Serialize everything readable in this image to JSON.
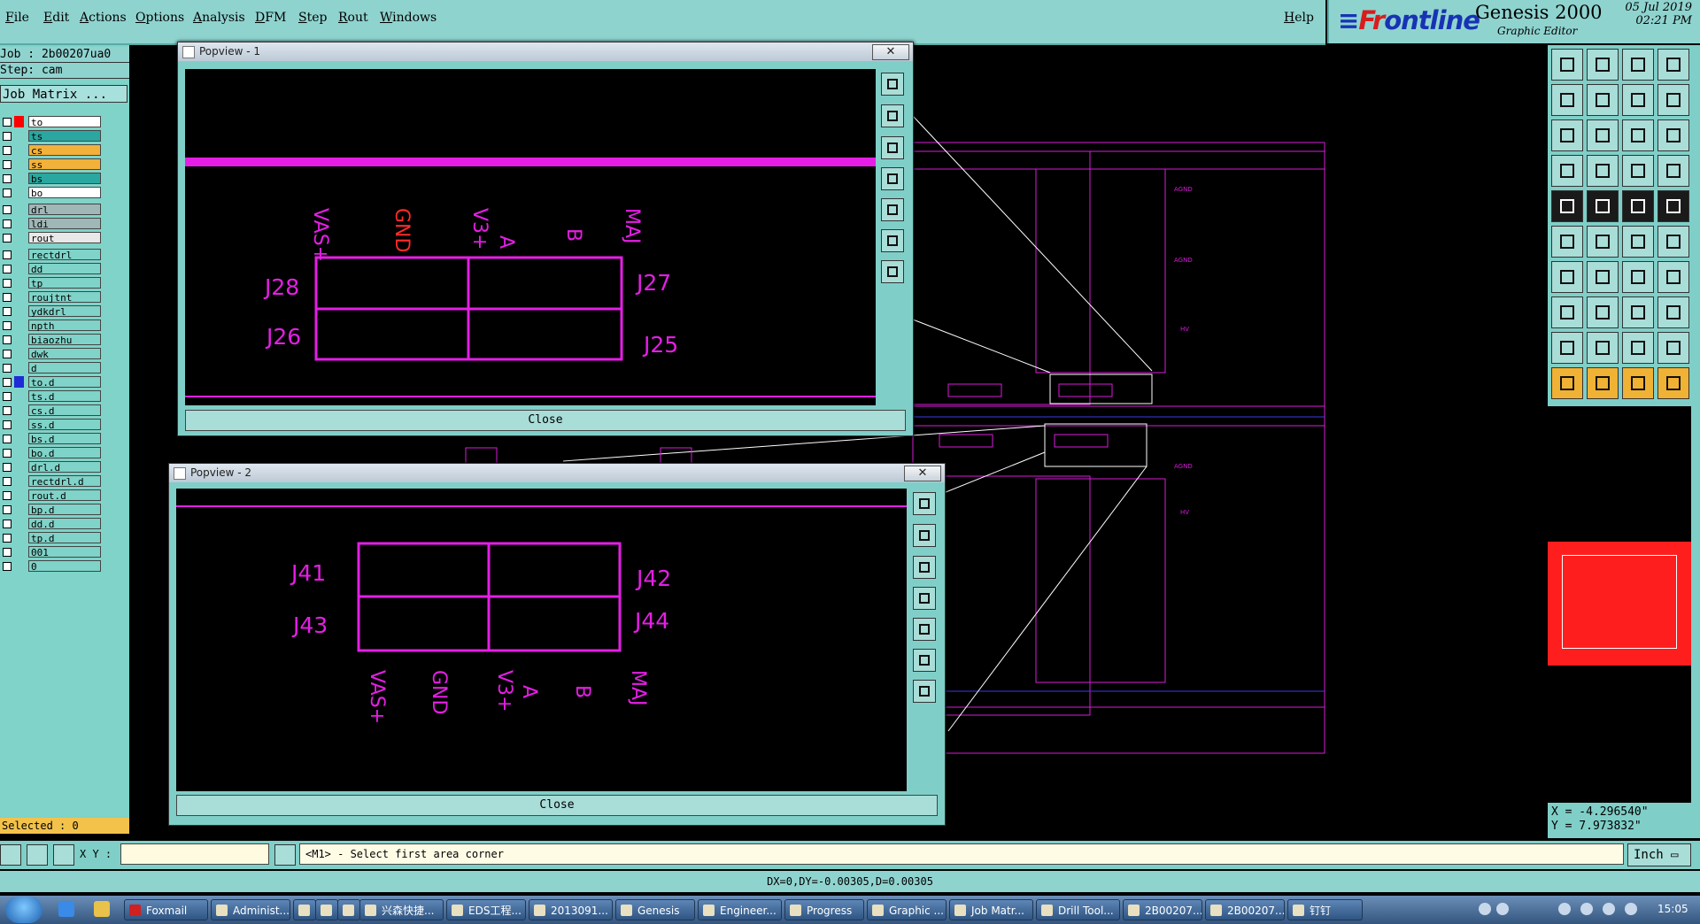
{
  "menu": [
    "File",
    "Edit",
    "Actions",
    "Options",
    "Analysis",
    "DFM",
    "Step",
    "Rout",
    "Windows"
  ],
  "help": "Help",
  "brand": {
    "logo_prefix": "Fr",
    "logo_rest": "ontline",
    "product": "Genesis 2000",
    "subtitle": "Graphic Editor",
    "date": "05 Jul 2019",
    "time": "02:21 PM"
  },
  "job": {
    "job_line": "Job : 2b00207ua0",
    "step_line": "Step: cam",
    "matrix": "Job Matrix ..."
  },
  "layers": [
    {
      "name": "to",
      "color": "#ffffff",
      "swatch": "#ff0000"
    },
    {
      "name": "ts",
      "color": "#2aa7a0"
    },
    {
      "name": "cs",
      "color": "#f2b13a"
    },
    {
      "name": "ss",
      "color": "#f2b13a"
    },
    {
      "name": "bs",
      "color": "#2aa7a0"
    },
    {
      "name": "bo",
      "color": "#ffffff"
    },
    {
      "name": "drl",
      "color": "#9fb7b7"
    },
    {
      "name": "ldi",
      "color": "#9fb7b7"
    },
    {
      "name": "rout",
      "color": "#e8e8e8"
    },
    {
      "name": "rectdrl",
      "color": "#7fd3c8"
    },
    {
      "name": "dd",
      "color": "#7fd3c8"
    },
    {
      "name": "tp",
      "color": "#7fd3c8"
    },
    {
      "name": "roujtnt",
      "color": "#7fd3c8"
    },
    {
      "name": "ydkdrl",
      "color": "#7fd3c8"
    },
    {
      "name": "npth",
      "color": "#7fd3c8"
    },
    {
      "name": "biaozhu",
      "color": "#7fd3c8"
    },
    {
      "name": "dwk",
      "color": "#7fd3c8"
    },
    {
      "name": "d",
      "color": "#7fd3c8"
    },
    {
      "name": "to.d",
      "color": "#7fd3c8",
      "swatch": "#1e2bd6"
    },
    {
      "name": "ts.d",
      "color": "#7fd3c8"
    },
    {
      "name": "cs.d",
      "color": "#7fd3c8"
    },
    {
      "name": "ss.d",
      "color": "#7fd3c8"
    },
    {
      "name": "bs.d",
      "color": "#7fd3c8"
    },
    {
      "name": "bo.d",
      "color": "#7fd3c8"
    },
    {
      "name": "drl.d",
      "color": "#7fd3c8"
    },
    {
      "name": "rectdrl.d",
      "color": "#7fd3c8"
    },
    {
      "name": "rout.d",
      "color": "#7fd3c8"
    },
    {
      "name": "bp.d",
      "color": "#7fd3c8"
    },
    {
      "name": "dd.d",
      "color": "#7fd3c8"
    },
    {
      "name": "tp.d",
      "color": "#7fd3c8"
    },
    {
      "name": "001",
      "color": "#7fd3c8"
    },
    {
      "name": "0",
      "color": "#7fd3c8"
    }
  ],
  "selected": "Selected : 0",
  "popup1": {
    "title": "Popview - 1",
    "close": "Close",
    "labels": {
      "j28": "J28",
      "j27": "J27",
      "j26": "J26",
      "j25": "J25",
      "vas": "VAS+",
      "gnd": "GND",
      "v3": "V3+",
      "a": "A",
      "b": "B",
      "maj": "MAJ"
    }
  },
  "popup2": {
    "title": "Popview - 2",
    "close": "Close",
    "labels": {
      "j41": "J41",
      "j42": "J42",
      "j43": "J43",
      "j44": "J44",
      "vas": "VAS+",
      "gnd": "GND",
      "v3": "V3+",
      "a": "A",
      "b": "B",
      "maj": "MAJ"
    }
  },
  "pcb_tiny": {
    "agnd": "AGND",
    "hv": "HV"
  },
  "toolbox_icons": [
    "output-icon",
    "input-icon",
    "home-icon",
    "layout-icon",
    "prev-step-icon",
    "next-step-icon",
    "back-icon",
    "redo-icon",
    "zoom-fit-icon",
    "pan-icon",
    "scale-icon",
    "help-icon",
    "route-icon",
    "wire-icon",
    "net-red-icon",
    "net-blue-icon",
    "select-icon",
    "draw-icon",
    "measure-icon",
    "dot-icon",
    "connect-icon",
    "cross-icon",
    "line-icon",
    "segment-icon",
    "angle-icon",
    "diag-icon",
    "arc-icon",
    "text-icon",
    "move-icon",
    "edit-line-icon",
    "align-icon",
    "grid-icon",
    "triangle-icon",
    "triangle-2-icon",
    "triangle-3-icon",
    "triangle-4-icon",
    "pointer-icon",
    "pointer-2-icon",
    "pointer-3-icon",
    "pointer-4-icon"
  ],
  "coords": {
    "x": "X = -4.296540\"",
    "y": "Y = 7.973832\""
  },
  "cmd": {
    "xy_label": "X Y :",
    "prompt": "<M1> - Select first area corner",
    "unit": "Inch"
  },
  "status": "DX=0,DY=-0.00305,D=0.00305",
  "taskbar": {
    "tasks": [
      "Foxmail",
      "Administ...",
      "",
      "",
      "",
      "兴森快捷...",
      "EDS工程...",
      "2013091...",
      "Genesis",
      "Engineer...",
      "Progress",
      "Graphic ...",
      "Job Matr...",
      "Drill Tool...",
      "2B00207...",
      "2B00207...",
      "钉钉"
    ],
    "clock": "15:05"
  }
}
